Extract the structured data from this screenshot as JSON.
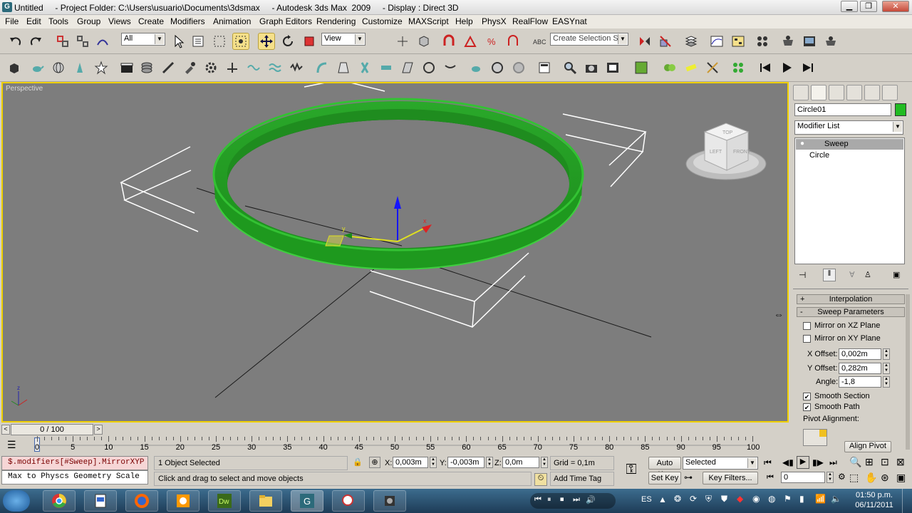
{
  "window": {
    "title": "Untitled     - Project Folder: C:\\Users\\usuario\\Documents\\3dsmax     - Autodesk 3ds Max  2009     - Display : Direct 3D",
    "minimize": "▁",
    "restore": "❐",
    "close": "✕"
  },
  "menu": [
    "File",
    "Edit",
    "Tools",
    "Group",
    "Views",
    "Create",
    "Modifiers",
    "Animation",
    "Graph Editors",
    "Rendering",
    "Customize",
    "MAXScript",
    "Help",
    "PhysX",
    "RealFlow",
    "EASYnat"
  ],
  "toolbar": {
    "filter_value": "All",
    "coord_value": "View",
    "selection_set_placeholder": "Create Selection Set"
  },
  "viewport": {
    "label": "Perspective",
    "viewcube_faces": [
      "TOP",
      "LEFT",
      "FRONT"
    ],
    "axis_labels": {
      "x": "x",
      "y": "y",
      "z": "z"
    }
  },
  "command_panel": {
    "object_name": "Circle01",
    "object_color": "#22bb22",
    "modifier_list": "Modifier List",
    "stack": [
      "Sweep",
      "Circle"
    ],
    "rollouts": {
      "interpolation": "Interpolation",
      "interpolation_sign": "+",
      "sweep_parameters": "Sweep Parameters",
      "sweep_sign": "-"
    },
    "params": {
      "mirror_xz": "Mirror on XZ Plane",
      "mirror_xy": "Mirror on XY Plane",
      "x_offset_label": "X Offset:",
      "x_offset": "0,002m",
      "y_offset_label": "Y Offset:",
      "y_offset": "0,282m",
      "angle_label": "Angle:",
      "angle": "-1,8",
      "smooth_section": "Smooth Section",
      "smooth_path": "Smooth Path",
      "pivot_alignment": "Pivot Alignment:",
      "align_pivot": "Align Pivot"
    }
  },
  "timeline": {
    "frame": "0 / 100",
    "ticks": [
      "0",
      "5",
      "10",
      "15",
      "20",
      "25",
      "30",
      "35",
      "40",
      "45",
      "50",
      "55",
      "60",
      "65",
      "70",
      "75",
      "80",
      "85",
      "90",
      "95",
      "100"
    ]
  },
  "status": {
    "maxscript_line1": "$.modifiers[#Sweep].MirrorXYP",
    "maxscript_line2": "Max to Physcs Geometry Scale",
    "selection": "1 Object Selected",
    "prompt": "Click and drag to select and move objects",
    "x_label": "X:",
    "x": "0,003m",
    "y_label": "Y:",
    "y": "-0,003m",
    "z_label": "Z:",
    "z": "0,0m",
    "grid": "Grid = 0,1m",
    "add_time_tag": "Add Time Tag",
    "auto_key": "Auto Key",
    "set_key": "Set Key",
    "key_mode": "Selected",
    "key_filters": "Key Filters...",
    "current_frame": "0"
  },
  "taskbar": {
    "lang": "ES",
    "time": "01:50 p.m.",
    "date": "06/11/2011"
  },
  "colors": {
    "viewport_bg": "#7d7d7d",
    "active_border": "#f0d000",
    "sweep_green": "#1f9a1f"
  }
}
